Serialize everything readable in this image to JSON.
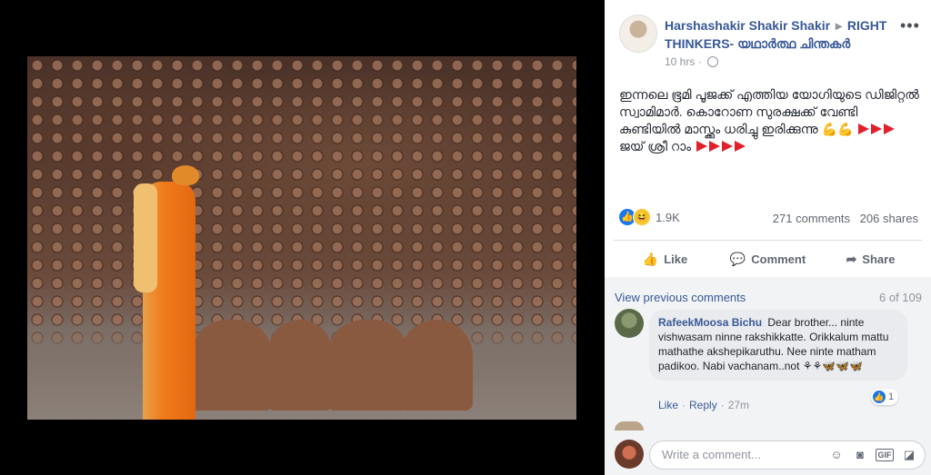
{
  "post": {
    "author_name": "Harshashakir Shakir Shakir",
    "separator": "▸",
    "group_name": "RIGHT THINKERS- യഥാർത്ഥ ചിന്തകർ",
    "time": "10 hrs",
    "dot": "·",
    "more_label": "•••",
    "text": "ഇന്നലെ ഭൂമി പൂജക്ക് എത്തിയ യോഗിയുടെ ഡിജിറ്റൽ സ്വാമിമാർ. കൊറോണ സുരക്ഷക്ക് വേണ്ടി കുണ്ടിയിൽ മാസ്ക്കും ധരിച്ചു ഇരിക്കുന്നു 💪💪",
    "text_tail": "ജയ് ശ്രീ റാം",
    "reactions_count": "1.9K",
    "comments_count": "271 comments",
    "shares_count": "206 shares",
    "colors": {
      "link": "#385898",
      "flag": "#e0202a",
      "like_blue": "#1877f2"
    }
  },
  "actions": {
    "like": "Like",
    "comment": "Comment",
    "share": "Share"
  },
  "comments": {
    "view_previous": "View previous comments",
    "page_count": "6 of 109",
    "items": [
      {
        "author": "RafeekMoosa Bichu",
        "text": "Dear brother... ninte vishwasam ninne rakshikkatte. Orikkalum mattu mathathe akshepikaruthu. Nee ninte matham padikoo. Nabi vachanam..not ⚘⚘🦋🦋🦋",
        "like_link": "Like",
        "reply_link": "Reply",
        "time": "27m",
        "reaction_count": "1"
      }
    ],
    "write_placeholder": "Write a comment..."
  },
  "icons": {
    "like": "thumbs-up-icon",
    "comment": "speech-bubble-icon",
    "share": "share-arrow-icon",
    "emoji": "smiley-icon",
    "camera": "camera-icon",
    "gif": "gif-icon",
    "sticker": "sticker-icon"
  }
}
